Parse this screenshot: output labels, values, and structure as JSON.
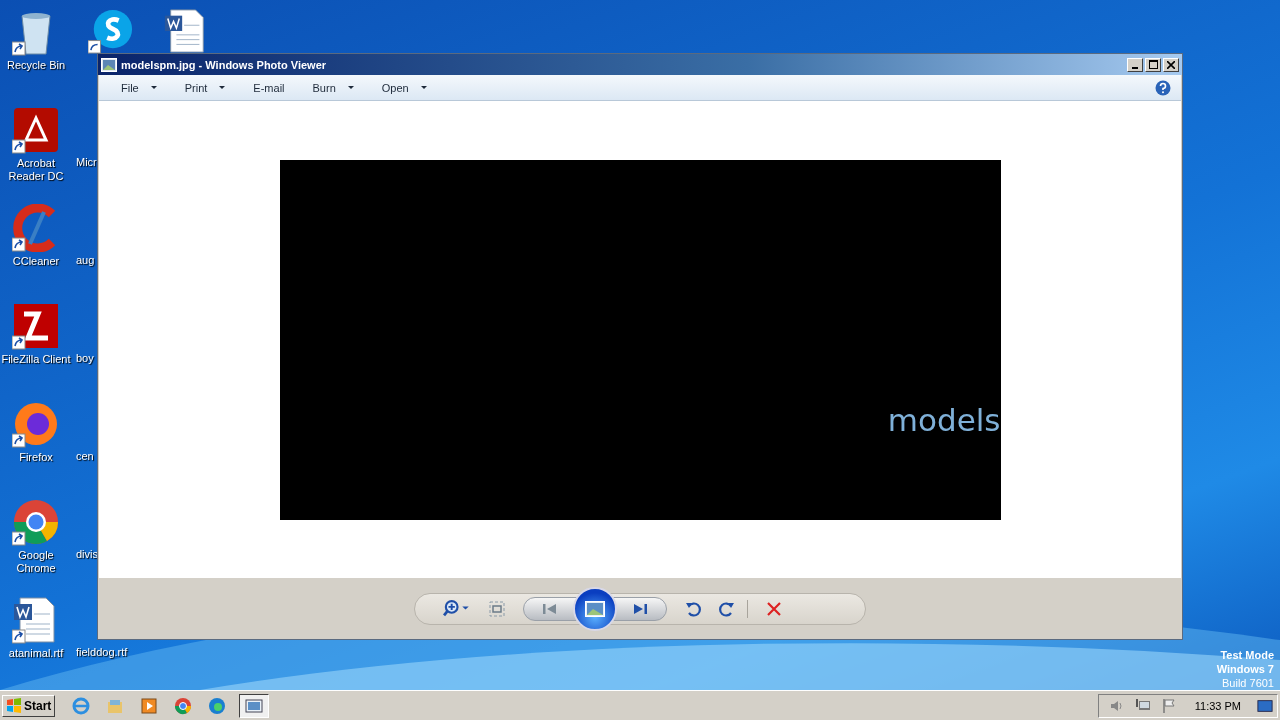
{
  "desktop_icons": [
    {
      "label": "Recycle Bin",
      "kind": "recycle"
    },
    {
      "label": "Acrobat Reader DC",
      "kind": "acrobat"
    },
    {
      "label": "CCleaner",
      "kind": "ccleaner"
    },
    {
      "label": "FileZilla Client",
      "kind": "filezilla"
    },
    {
      "label": "Firefox",
      "kind": "firefox"
    },
    {
      "label": "Google Chrome",
      "kind": "chrome"
    },
    {
      "label": "atanimal.rtf",
      "kind": "word"
    }
  ],
  "top_icons": [
    {
      "kind": "skype"
    },
    {
      "kind": "word"
    }
  ],
  "covered_labels": [
    "Micr",
    "aug",
    "boy",
    "cen",
    "divis",
    "fielddog.rtf"
  ],
  "window": {
    "title": "modelspm.jpg - Windows Photo Viewer",
    "menu": [
      {
        "label": "File",
        "dropdown": true
      },
      {
        "label": "Print",
        "dropdown": true
      },
      {
        "label": "E-mail",
        "dropdown": false
      },
      {
        "label": "Burn",
        "dropdown": true
      },
      {
        "label": "Open",
        "dropdown": true
      }
    ],
    "image_text": "models"
  },
  "system_notice": [
    "Test Mode",
    "Windows 7",
    "Build 7601"
  ],
  "taskbar": {
    "start": "Start",
    "apps": [
      {
        "kind": "ie",
        "selected": false
      },
      {
        "kind": "folder",
        "selected": false
      },
      {
        "kind": "media",
        "selected": false
      },
      {
        "kind": "chrome",
        "selected": false
      },
      {
        "kind": "edge",
        "selected": false
      },
      {
        "kind": "photo",
        "selected": true
      }
    ],
    "clock": "11:33 PM"
  }
}
